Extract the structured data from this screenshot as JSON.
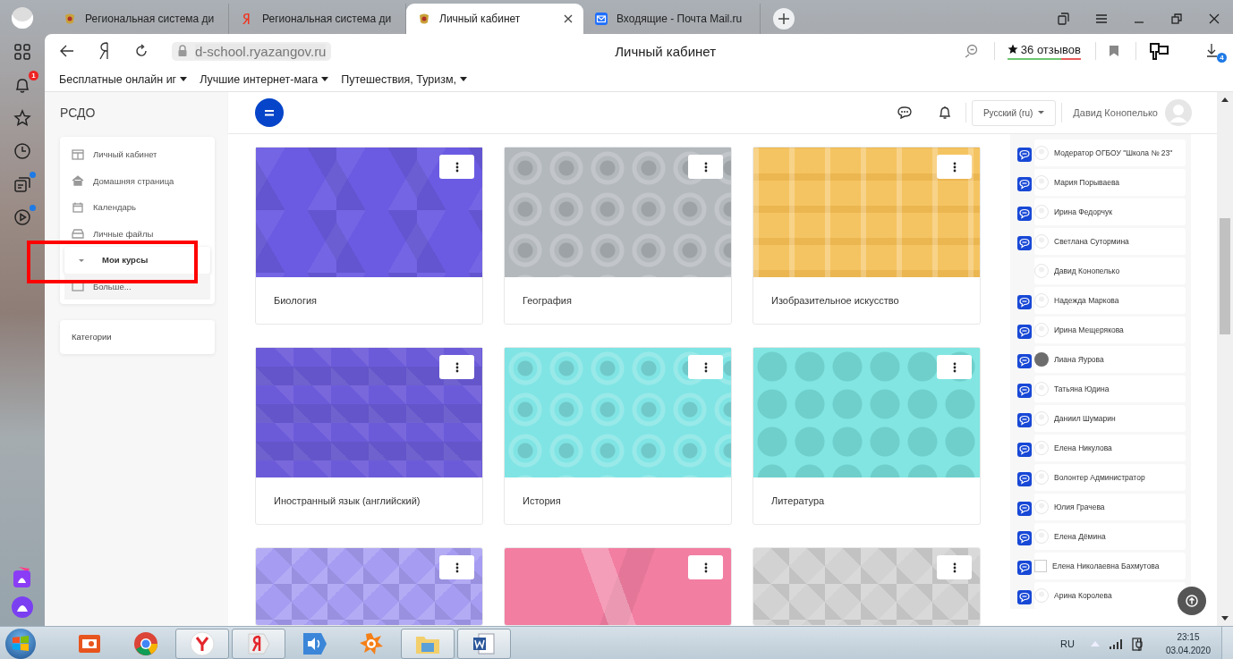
{
  "browser_sidebar": {
    "items": [
      {
        "kind": "apps",
        "dot": false
      },
      {
        "kind": "bell",
        "dot": false,
        "badge": "1"
      },
      {
        "kind": "star",
        "dot": false
      },
      {
        "kind": "history",
        "dot": false
      },
      {
        "kind": "collections",
        "dot": true
      },
      {
        "kind": "video",
        "dot": true
      }
    ],
    "bottom": [
      {
        "kind": "alice-square"
      },
      {
        "kind": "alice-circle"
      }
    ]
  },
  "tabs": [
    {
      "title": "Региональная система ди",
      "kind": "crest",
      "selected": false
    },
    {
      "title": "Региональная система ди",
      "kind": "yandex",
      "selected": false
    },
    {
      "title": "Личный кабинет",
      "kind": "crest",
      "selected": true
    },
    {
      "title": "Входящие - Почта Mail.ru",
      "kind": "mail",
      "selected": false
    }
  ],
  "address_bar": {
    "url": "d-school.ryazangov.ru",
    "page_title": "Личный кабинет",
    "reviews": "36 отзывов",
    "level": 0.73,
    "downloads_badge": "4"
  },
  "bookmarks": [
    "Бесплатные онлайн иг",
    "Лучшие интернет-мага",
    "Путешествия, Туризм,"
  ],
  "site": {
    "name": "РСДО",
    "language": "Русский (ru)",
    "user": "Давид Конопелько",
    "nav": [
      {
        "label": "Личный кабинет",
        "kind": "dashboard",
        "selected": false,
        "highlighted": false
      },
      {
        "label": "Домашняя страница",
        "kind": "home",
        "selected": false,
        "highlighted": false
      },
      {
        "label": "Календарь",
        "kind": "calendar",
        "selected": false,
        "highlighted": false
      },
      {
        "label": "Личные файлы",
        "kind": "files",
        "selected": false,
        "highlighted": false
      },
      {
        "label": "Мои курсы",
        "kind": "caret",
        "selected": true,
        "highlighted": true
      },
      {
        "label": "Больше...",
        "kind": "more",
        "selected": false,
        "highlighted": false
      }
    ],
    "categories": "Категории"
  },
  "courses": [
    {
      "title": "Биология",
      "color": "#6b5be2",
      "kind": "polygons"
    },
    {
      "title": "География",
      "color": "#b3b8bd",
      "kind": "circles"
    },
    {
      "title": "Изобразительное искусство",
      "color": "#f5c462",
      "kind": "plaid"
    },
    {
      "title": "Иностранный язык (английский)",
      "color": "#6c5bd9",
      "kind": "squares"
    },
    {
      "title": "История",
      "color": "#80e4e4",
      "kind": "circles"
    },
    {
      "title": "Литература",
      "color": "#82e5e1",
      "kind": "octagons"
    },
    {
      "color": "#a69cf2",
      "kind": "diamonds"
    },
    {
      "color": "#f27ea2",
      "kind": "chevrons"
    },
    {
      "color": "#d2d2d2",
      "kind": "diamonds"
    }
  ],
  "participants": [
    {
      "name": "Модератор ОГБОУ \"Школа № 23\"",
      "message": true,
      "kind": "default"
    },
    {
      "name": "Мария Порываева",
      "message": true,
      "kind": "default"
    },
    {
      "name": "Ирина Федорчук",
      "message": true,
      "kind": "default"
    },
    {
      "name": "Светлана Сутормина",
      "message": true,
      "kind": "default"
    },
    {
      "name": "Давид Конопелько",
      "message": false,
      "kind": "default"
    },
    {
      "name": "Надежда Маркова",
      "message": true,
      "kind": "default"
    },
    {
      "name": "Ирина Мещерякова",
      "message": true,
      "kind": "default"
    },
    {
      "name": "Лиана Яурова",
      "message": true,
      "kind": "photo"
    },
    {
      "name": "Татьяна Юдина",
      "message": true,
      "kind": "default"
    },
    {
      "name": "Даниил Шумарин",
      "message": true,
      "kind": "default"
    },
    {
      "name": "Елена Никулова",
      "message": true,
      "kind": "default"
    },
    {
      "name": "Волонтер Администратор",
      "message": true,
      "kind": "default"
    },
    {
      "name": "Юлия Грачева",
      "message": true,
      "kind": "default"
    },
    {
      "name": "Елена Дёмина",
      "message": true,
      "kind": "default"
    },
    {
      "name": "Елена Николаевна Бахмутова",
      "message": true,
      "kind": "blank"
    },
    {
      "name": "Арина Королева",
      "message": true,
      "kind": "default"
    }
  ],
  "taskbar": {
    "apps": [
      {
        "kind": "presentation",
        "open": false
      },
      {
        "kind": "chrome",
        "open": false
      },
      {
        "kind": "yandex-browser",
        "open": true
      },
      {
        "kind": "yandex",
        "open": true
      },
      {
        "kind": "speaker",
        "open": false
      },
      {
        "kind": "antivirus",
        "open": false
      },
      {
        "kind": "folder",
        "open": true
      },
      {
        "kind": "word",
        "open": true
      }
    ],
    "language": "RU",
    "time": "23:15",
    "date": "03.04.2020"
  }
}
